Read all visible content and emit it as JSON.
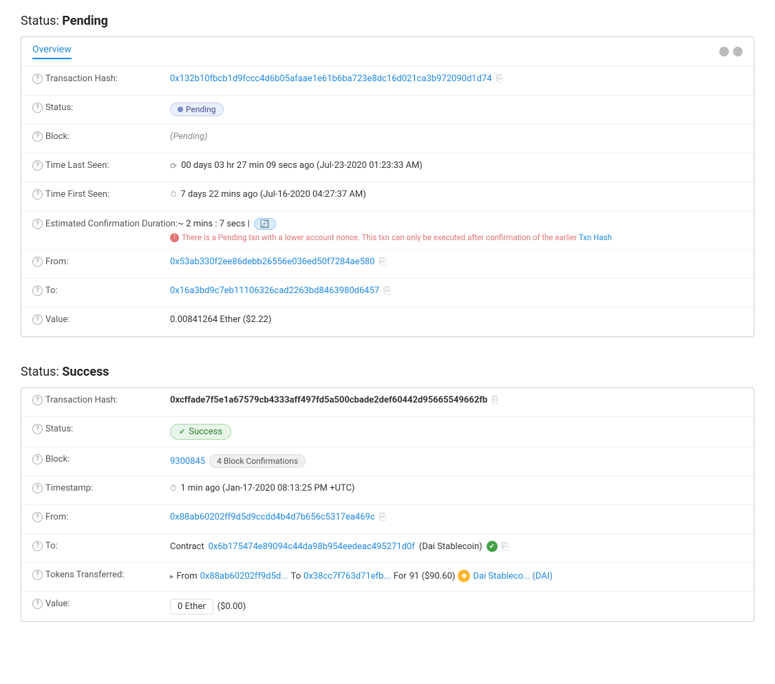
{
  "pending_section": {
    "title_prefix": "Status:",
    "title_bold": "Pending",
    "tab_label": "Overview",
    "rows": {
      "tx_hash_label": "Transaction Hash:",
      "tx_hash_value": "0x132b10fbcb1d9fccc4d6b05afaae1e61b6ba723e8dc16d021ca3b972090d1d74",
      "status_label": "Status:",
      "status_value": "Pending",
      "block_label": "Block:",
      "block_value": "(Pending)",
      "time_last_seen_label": "Time Last Seen:",
      "time_last_seen_value": "00 days 03 hr 27 min 09 secs ago (Jul-23-2020 01:23:33 AM)",
      "time_first_seen_label": "Time First Seen:",
      "time_first_seen_value": "7 days 22 mins ago (Jul-16-2020 04:27:37 AM)",
      "est_confirm_label": "Estimated Confirmation Duration:",
      "est_confirm_value": "~ 2 mins : 7 secs |",
      "est_confirm_sub": "There is a Pending txn with a lower account nonce. This txn can only be executed after confirmation of the earlier Txn Hash",
      "from_label": "From:",
      "from_value": "0x53ab330f2ee86debb26556e036ed50f7284ae580",
      "to_label": "To:",
      "to_value": "0x16a3bd9c7eb11106326cad2263bd8463980d6457",
      "value_label": "Value:",
      "value_value": "0.00841264 Ether ($2.22)"
    }
  },
  "success_section": {
    "title_prefix": "Status:",
    "title_bold": "Success",
    "rows": {
      "tx_hash_label": "Transaction Hash:",
      "tx_hash_value": "0xcffade7f5e1a67579cb4333aff497fd5a500cbade2def60442d95665549662fb",
      "status_label": "Status:",
      "status_value": "Success",
      "block_label": "Block:",
      "block_number": "9300845",
      "block_confirmations": "4 Block Confirmations",
      "timestamp_label": "Timestamp:",
      "timestamp_value": "1 min ago (Jan-17-2020 08:13:25 PM +UTC)",
      "from_label": "From:",
      "from_value": "0x88ab60202ff9d5d9ccdd4b4d7b656c5317ea469c",
      "to_label": "To:",
      "to_contract_label": "Contract",
      "to_contract_address": "0x6b175474e89094c44da98b954eedeac495271d0f",
      "to_contract_name": "(Dai Stablecoin)",
      "tokens_label": "Tokens Transferred:",
      "tokens_from_label": "From",
      "tokens_from_address": "0x88ab60202ff9d5d...",
      "tokens_to_label": "To",
      "tokens_to_address": "0x38cc7f763d71efb...",
      "tokens_for_label": "For",
      "tokens_amount": "91 ($90.60)",
      "tokens_name": "Dai Stableco... (DAI)",
      "value_label": "Value:",
      "value_ether": "0 Ether",
      "value_usd": "($0.00)"
    }
  }
}
